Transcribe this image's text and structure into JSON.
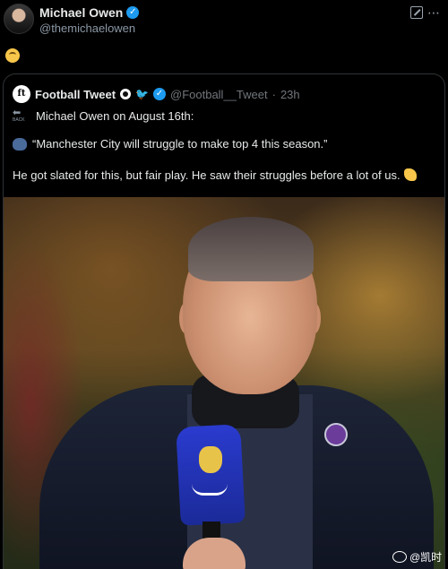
{
  "tweet": {
    "author_name": "Michael Owen",
    "author_handle": "@themichaelowen",
    "body_emoji": "upside-down-face"
  },
  "quoted": {
    "author_name": "Football Tweet",
    "author_handle": "@Football__Tweet",
    "time": "23h",
    "line1": "Michael Owen on August 16th:",
    "back_label": "BACK",
    "line2": "“Manchester City will struggle to make top 4 this season.”",
    "line3": "He got slated for this, but fair play. He saw their struggles before a lot of us."
  },
  "watermark": {
    "text": "@凯时"
  },
  "colors": {
    "background": "#000000",
    "verified": "#1d9bf0",
    "text": "#e7e9ea",
    "muted": "#71767b",
    "mic": "#2a3bcf"
  },
  "icons": [
    "verified-icon",
    "edit-icon",
    "more-icon",
    "upside-down-face-emoji",
    "football-icon",
    "bird-icon",
    "back-arrow-icon",
    "speaking-head-icon",
    "clapping-hands-icon",
    "weibo-icon"
  ]
}
